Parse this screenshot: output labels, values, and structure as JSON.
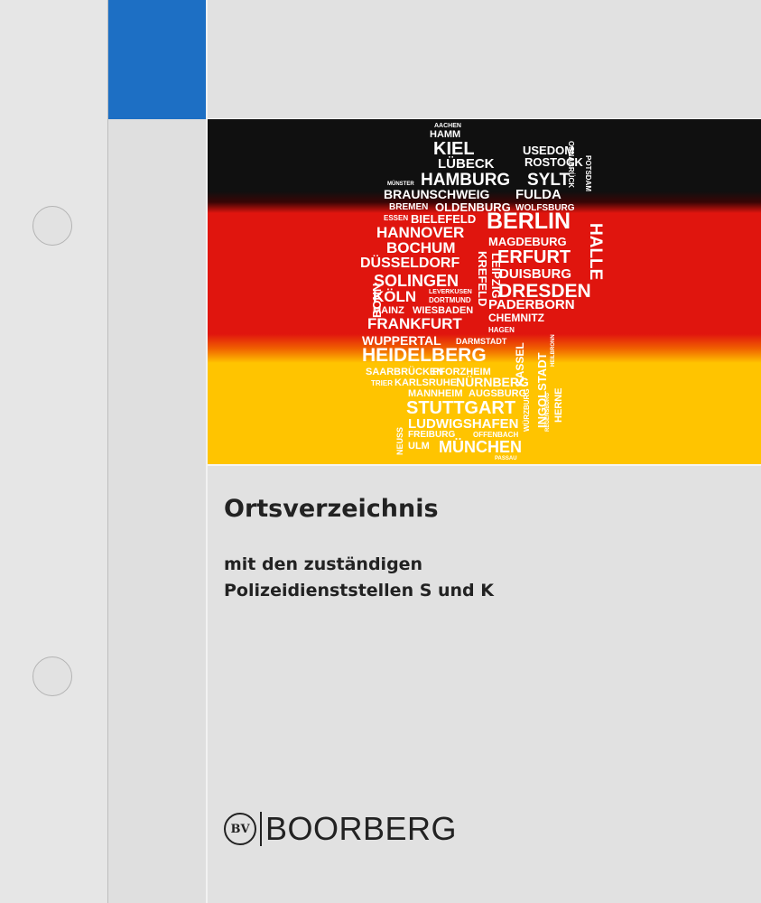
{
  "cover": {
    "title": "Ortsverzeichnis",
    "subtitle_line1": "mit den zuständigen",
    "subtitle_line2": "Polizeidienststellen S und K",
    "publisher": "BOORBERG",
    "publisher_logo_text": "BV"
  },
  "colors": {
    "tab": "#1d6fc4",
    "flag_black": "#101010",
    "flag_red": "#e0150e",
    "flag_gold": "#ffc400",
    "background": "#e1e1e1"
  },
  "cities": {
    "aachen": "AACHEN",
    "hamm": "HAMM",
    "kiel": "KIEL",
    "usedom": "USEDOM",
    "rostock": "ROSTOCK",
    "luebeck": "LÜBECK",
    "hamburg": "HAMBURG",
    "sylt": "SYLT",
    "osnabrueck": "OSNABRÜCK",
    "potsdam": "POTSDAM",
    "muenster": "MÜNSTER",
    "braunschweig": "BRAUNSCHWEIG",
    "fulda": "FULDA",
    "bremen": "BREMEN",
    "oldenburg": "OLDENBURG",
    "wolfsburg": "WOLFSBURG",
    "essen": "ESSEN",
    "bielefeld": "BIELEFELD",
    "berlin": "BERLIN",
    "hannover": "HANNOVER",
    "magdeburg": "MAGDEBURG",
    "bochum": "BOCHUM",
    "erfurt": "ERFURT",
    "halle": "HALLE",
    "duesseldorf": "DÜSSELDORF",
    "duisburg": "DUISBURG",
    "solingen": "SOLINGEN",
    "krefeld": "KREFELD",
    "leipzig": "LEIPZIG",
    "dresden": "DRESDEN",
    "bonn": "BONN",
    "koeln": "KÖLN",
    "leverkusen": "LEVERKUSEN",
    "dortmund": "DORTMUND",
    "paderborn": "PADERBORN",
    "mainz": "MAINZ",
    "wiesbaden": "WIESBADEN",
    "chemnitz": "CHEMNITZ",
    "frankfurt": "FRANKFURT",
    "hagen": "HAGEN",
    "wuppertal": "WUPPERTAL",
    "darmstadt": "DARMSTADT",
    "heidelberg": "HEIDELBERG",
    "heilbronn": "HEILBRONN",
    "kassel": "KASSEL",
    "saarbruecken": "SAARBRÜCKEN",
    "pforzheim": "PFORZHEIM",
    "trier": "TRIER",
    "karlsruhe": "KARLSRUHE",
    "nuernberg": "NÜRNBERG",
    "ingolstadt": "INGOLSTADT",
    "mannheim": "MANNHEIM",
    "augsburg": "AUGSBURG",
    "wuerzburg": "WÜRZBURG",
    "regensburg": "REGENSBURG",
    "herne": "HERNE",
    "stuttgart": "STUTTGART",
    "ludwigshafen": "LUDWIGSHAFEN",
    "neuss": "NEUSS",
    "freiburg": "FREIBURG",
    "offenbach": "OFFENBACH",
    "ulm": "ULM",
    "muenchen": "MÜNCHEN",
    "passau": "PASSAU"
  }
}
